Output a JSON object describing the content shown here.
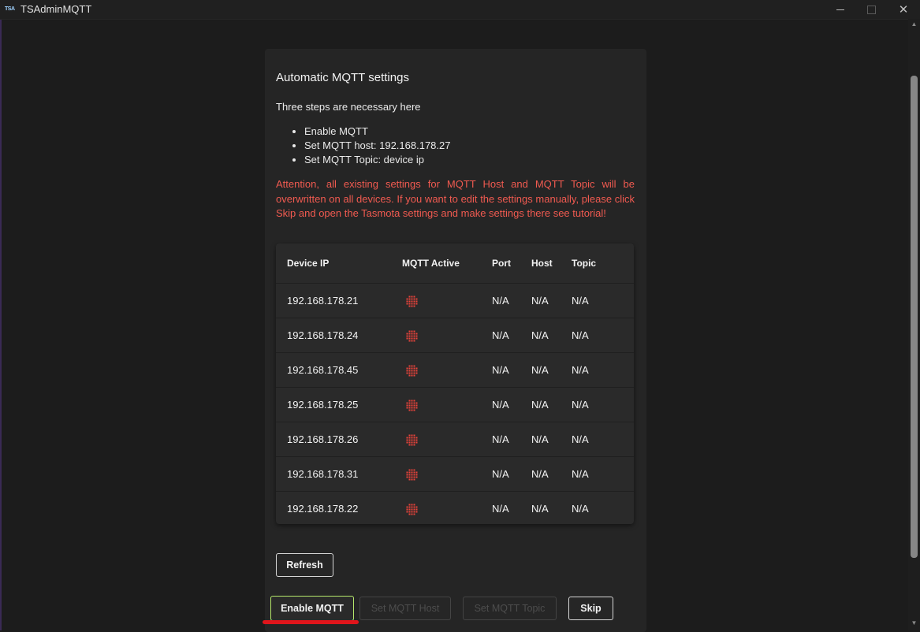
{
  "window": {
    "app_icon_text": "TSA",
    "title": "TSAdminMQTT"
  },
  "card": {
    "title": "Automatic MQTT settings",
    "intro": "Three steps are necessary here",
    "steps": [
      "Enable MQTT",
      "Set MQTT host: 192.168.178.27",
      "Set MQTT Topic: device ip"
    ],
    "warning": "Attention, all existing settings for MQTT Host and MQTT Topic will be overwritten on all devices. If you want to edit the settings manually, please click Skip and open the Tasmota settings and make settings there see tutorial!"
  },
  "table": {
    "headers": [
      "Device IP",
      "MQTT Active",
      "Port",
      "Host",
      "Topic"
    ],
    "rows": [
      {
        "ip": "192.168.178.21",
        "active_icon": "red-dotgrid-icon",
        "port": "N/A",
        "host": "N/A",
        "topic": "N/A"
      },
      {
        "ip": "192.168.178.24",
        "active_icon": "red-dotgrid-icon",
        "port": "N/A",
        "host": "N/A",
        "topic": "N/A"
      },
      {
        "ip": "192.168.178.45",
        "active_icon": "red-dotgrid-icon",
        "port": "N/A",
        "host": "N/A",
        "topic": "N/A"
      },
      {
        "ip": "192.168.178.25",
        "active_icon": "red-dotgrid-icon",
        "port": "N/A",
        "host": "N/A",
        "topic": "N/A"
      },
      {
        "ip": "192.168.178.26",
        "active_icon": "red-dotgrid-icon",
        "port": "N/A",
        "host": "N/A",
        "topic": "N/A"
      },
      {
        "ip": "192.168.178.31",
        "active_icon": "red-dotgrid-icon",
        "port": "N/A",
        "host": "N/A",
        "topic": "N/A"
      },
      {
        "ip": "192.168.178.22",
        "active_icon": "red-dotgrid-icon",
        "port": "N/A",
        "host": "N/A",
        "topic": "N/A"
      }
    ]
  },
  "buttons": {
    "refresh": "Refresh",
    "enable_mqtt": "Enable MQTT",
    "set_host": "Set MQTT Host",
    "set_topic": "Set MQTT Topic",
    "skip": "Skip"
  },
  "colors": {
    "warning": "#f05a50",
    "inactive_indicator": "#e8433a",
    "enable_border": "#b6e86b",
    "highlight_mark": "#e0151b"
  }
}
